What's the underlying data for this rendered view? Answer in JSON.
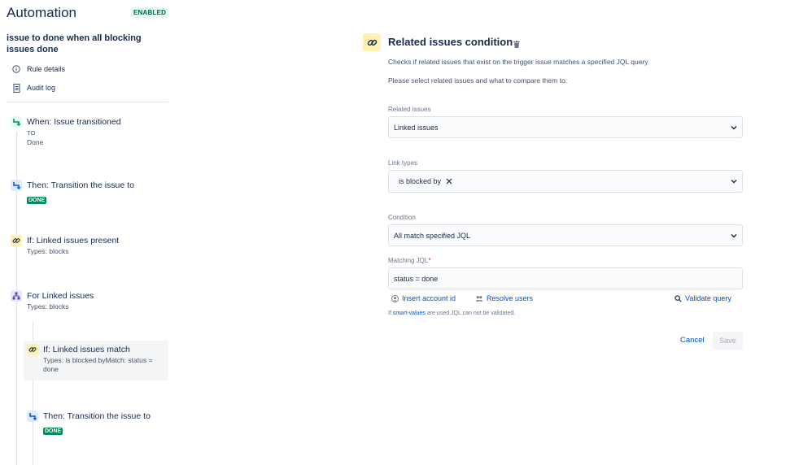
{
  "app": {
    "title": "Automation",
    "status_badge": "ENABLED"
  },
  "rule": {
    "name": "issue to done when all blocking issues done"
  },
  "nav": [
    {
      "label": "Rule details",
      "icon": "info-icon"
    },
    {
      "label": "Audit log",
      "icon": "document-icon"
    }
  ],
  "steps": {
    "trigger": {
      "title": "When: Issue transitioned",
      "line1": "TO",
      "line2": "Done"
    },
    "action1": {
      "title": "Then: Transition the issue to",
      "lozenge": "DONE"
    },
    "condition1": {
      "title": "If: Linked issues present",
      "sub": "Types: blocks"
    },
    "branch": {
      "title": "For Linked issues",
      "sub": "Types: blocks"
    },
    "condition2": {
      "title": "If: Linked issues match",
      "sub": "Types: is blocked byMatch: status = done"
    },
    "action2": {
      "title": "Then: Transition the issue to",
      "lozenge": "DONE"
    }
  },
  "panel": {
    "title": "Related issues condition",
    "description": "Checks if related issues that exist on the trigger issue matches a specified JQL query.",
    "instruction": "Please select related issues and what to compare them to:",
    "related_issues": {
      "label": "Related issues",
      "value": "Linked issues"
    },
    "link_types": {
      "label": "Link types",
      "chip": "is blocked by"
    },
    "condition": {
      "label": "Condition",
      "value": "All match specified JQL"
    },
    "matching_jql": {
      "label": "Matching JQL",
      "required_mark": "*",
      "value": "status = done"
    },
    "actions": {
      "insert_account": "Insert account id",
      "resolve_users": "Resolve users",
      "validate_query": "Validate query"
    },
    "hint": {
      "prefix": "If",
      "link": "smart-values",
      "suffix": "are used JQL can not be validated."
    },
    "cancel": "Cancel",
    "save": "Save"
  },
  "colors": {
    "accent": "#0052cc",
    "success": "#00875a",
    "condition_icon_bg": "#fff0b3"
  }
}
